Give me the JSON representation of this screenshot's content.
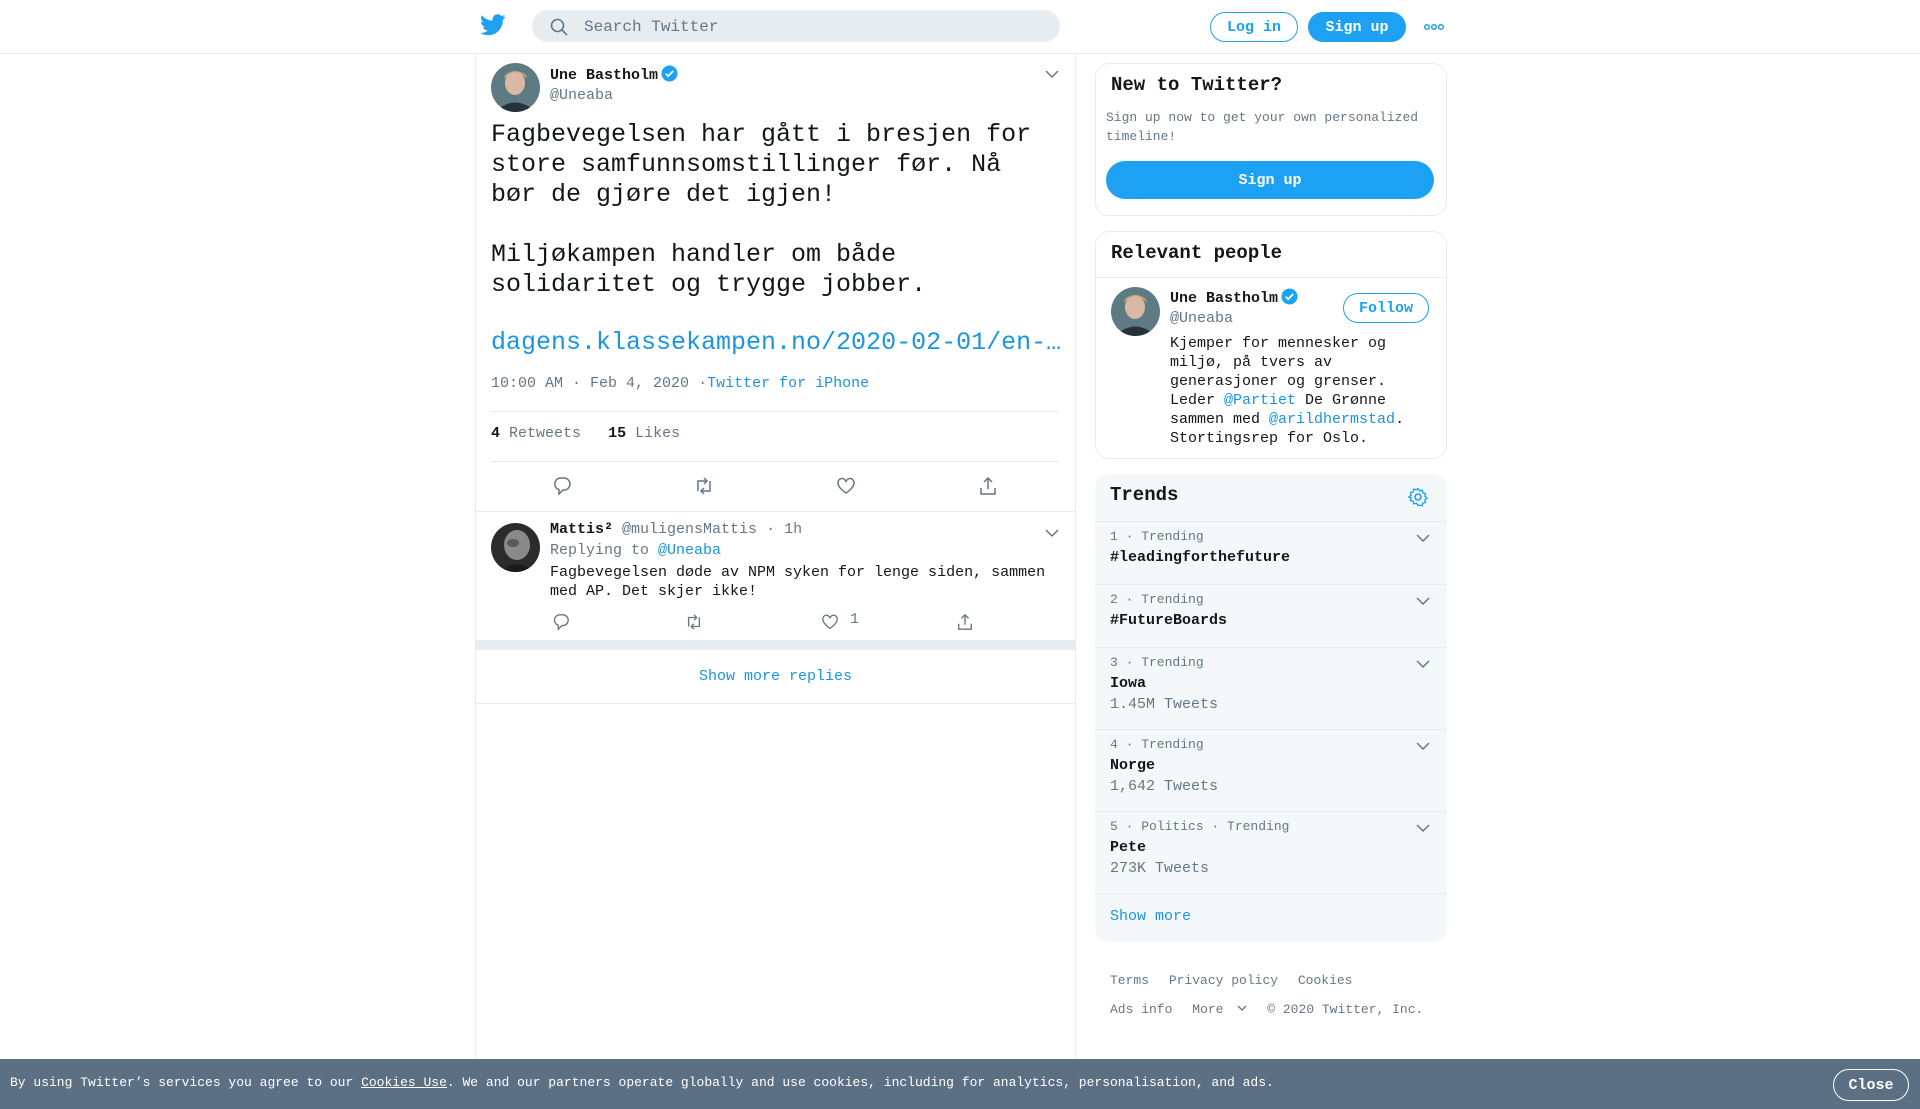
{
  "header": {
    "search_placeholder": "Search Twitter",
    "login_label": "Log in",
    "signup_label": "Sign up"
  },
  "tweet": {
    "author_name": "Une Bastholm",
    "author_handle": "@Uneaba",
    "text_p1": "Fagbevegelsen har gått i bresjen for store samfunnsomstillinger før. Nå bør de gjøre det igjen!",
    "text_p2": "Miljøkampen handler om både solidaritet og trygge jobber.",
    "link": "dagens.klassekampen.no/2020-02-01/en-…",
    "time": "10:00 AM · Feb 4, 2020",
    "separator": "·",
    "source": "Twitter for iPhone",
    "retweets_count": "4",
    "retweets_label": "Retweets",
    "likes_count": "15",
    "likes_label": "Likes"
  },
  "reply": {
    "author_name": "Mattis²",
    "author_handle": "@muligensMattis",
    "time": "· 1h",
    "replying_to_label": "Replying to",
    "replying_to_handle": "@Uneaba",
    "text": "Fagbevegelsen døde av NPM syken for lenge siden, sammen med AP. Det skjer ikke!",
    "like_count": "1"
  },
  "show_more_replies": "Show more replies",
  "new_to_twitter": {
    "title": "New to Twitter?",
    "text": "Sign up now to get your own personalized timeline!",
    "button": "Sign up"
  },
  "relevant_people": {
    "title": "Relevant people",
    "name": "Une Bastholm",
    "handle": "@Uneaba",
    "follow_label": "Follow",
    "bio_1": "Kjemper for mennesker og miljø, på tvers av generasjoner og grenser. Leder ",
    "bio_mention_1": "@Partiet",
    "bio_2": " De Grønne sammen med ",
    "bio_mention_2": "@arildhermstad",
    "bio_3": ". Stortingsrep for Oslo."
  },
  "trends": {
    "title": "Trends",
    "items": [
      {
        "sub": "1 · Trending",
        "name": "#leadingforthefuture",
        "count": ""
      },
      {
        "sub": "2 · Trending",
        "name": "#FutureBoards",
        "count": ""
      },
      {
        "sub": "3 · Trending",
        "name": "Iowa",
        "count": "1.45M Tweets"
      },
      {
        "sub": "4 · Trending",
        "name": "Norge",
        "count": "1,642 Tweets"
      },
      {
        "sub": "5 · Politics · Trending",
        "name": "Pete",
        "count": "273K Tweets"
      }
    ],
    "show_more": "Show more"
  },
  "footer": {
    "terms": "Terms",
    "privacy": "Privacy policy",
    "cookies": "Cookies",
    "ads_info": "Ads info",
    "more": "More",
    "copyright": "© 2020 Twitter, Inc."
  },
  "cookie_bar": {
    "text_before": "By using Twitter’s services you agree to our ",
    "link": "Cookies Use",
    "text_after": ". We and our partners operate globally and use cookies, including for analytics, personalisation, and ads.",
    "close_label": "Close"
  },
  "colors": {
    "brand_blue": "#1da1f2",
    "link_blue": "#1b95e0",
    "cookie_bar_bg": "#5b7083",
    "muted_text": "#657786"
  }
}
